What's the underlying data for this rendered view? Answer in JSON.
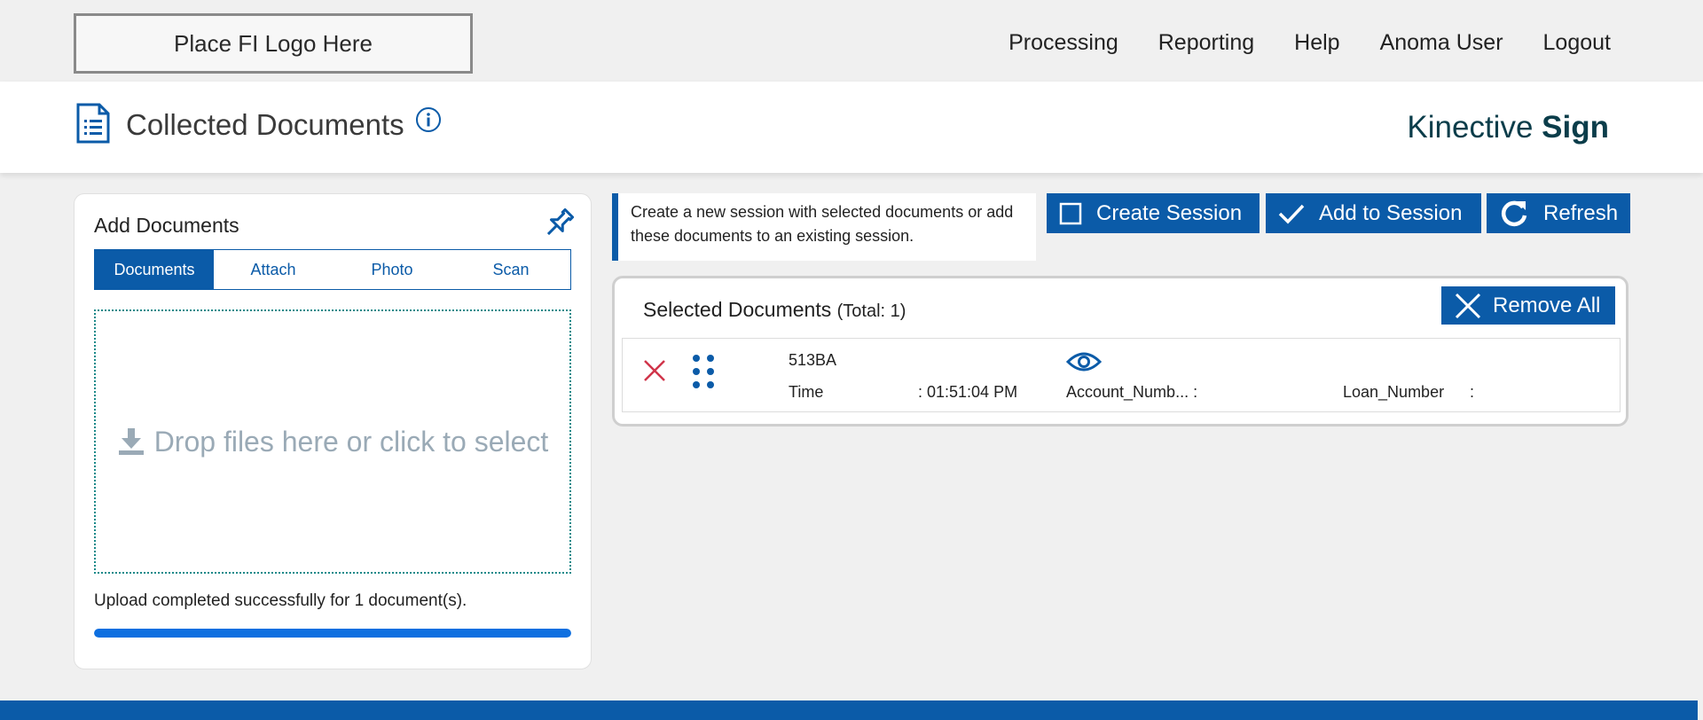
{
  "topbar": {
    "logo_text": "Place FI Logo Here",
    "nav": [
      "Processing",
      "Reporting",
      "Help",
      "Anoma User",
      "Logout"
    ]
  },
  "header": {
    "title": "Collected Documents",
    "brand_regular": "Kinective",
    "brand_bold": "Sign"
  },
  "add_documents": {
    "title": "Add Documents",
    "tabs": [
      "Documents",
      "Attach",
      "Photo",
      "Scan"
    ],
    "active_tab": "Documents",
    "dropzone_text": "Drop files here or click to select",
    "status": "Upload completed successfully for 1 document(s).",
    "progress_percent": 100
  },
  "actions": {
    "hint": "Create a new session with selected documents or add these documents to an existing session.",
    "create_session": "Create Session",
    "add_to_session": "Add to Session",
    "refresh": "Refresh"
  },
  "selected": {
    "title": "Selected Documents",
    "total": "(Total: 1)",
    "remove_all": "Remove All",
    "documents": [
      {
        "name": "513BA",
        "time_label": "Time",
        "time_value": ": 01:51:04 PM",
        "account_label": "Account_Numb... :",
        "loan_label": "Loan_Number",
        "loan_value": ":"
      }
    ]
  },
  "colors": {
    "primary": "#0b5ba8",
    "brand_dark": "#0b3d4a",
    "danger": "#d0344a",
    "progress": "#0d6fe0",
    "dropzone_border": "#1a8a8a"
  }
}
